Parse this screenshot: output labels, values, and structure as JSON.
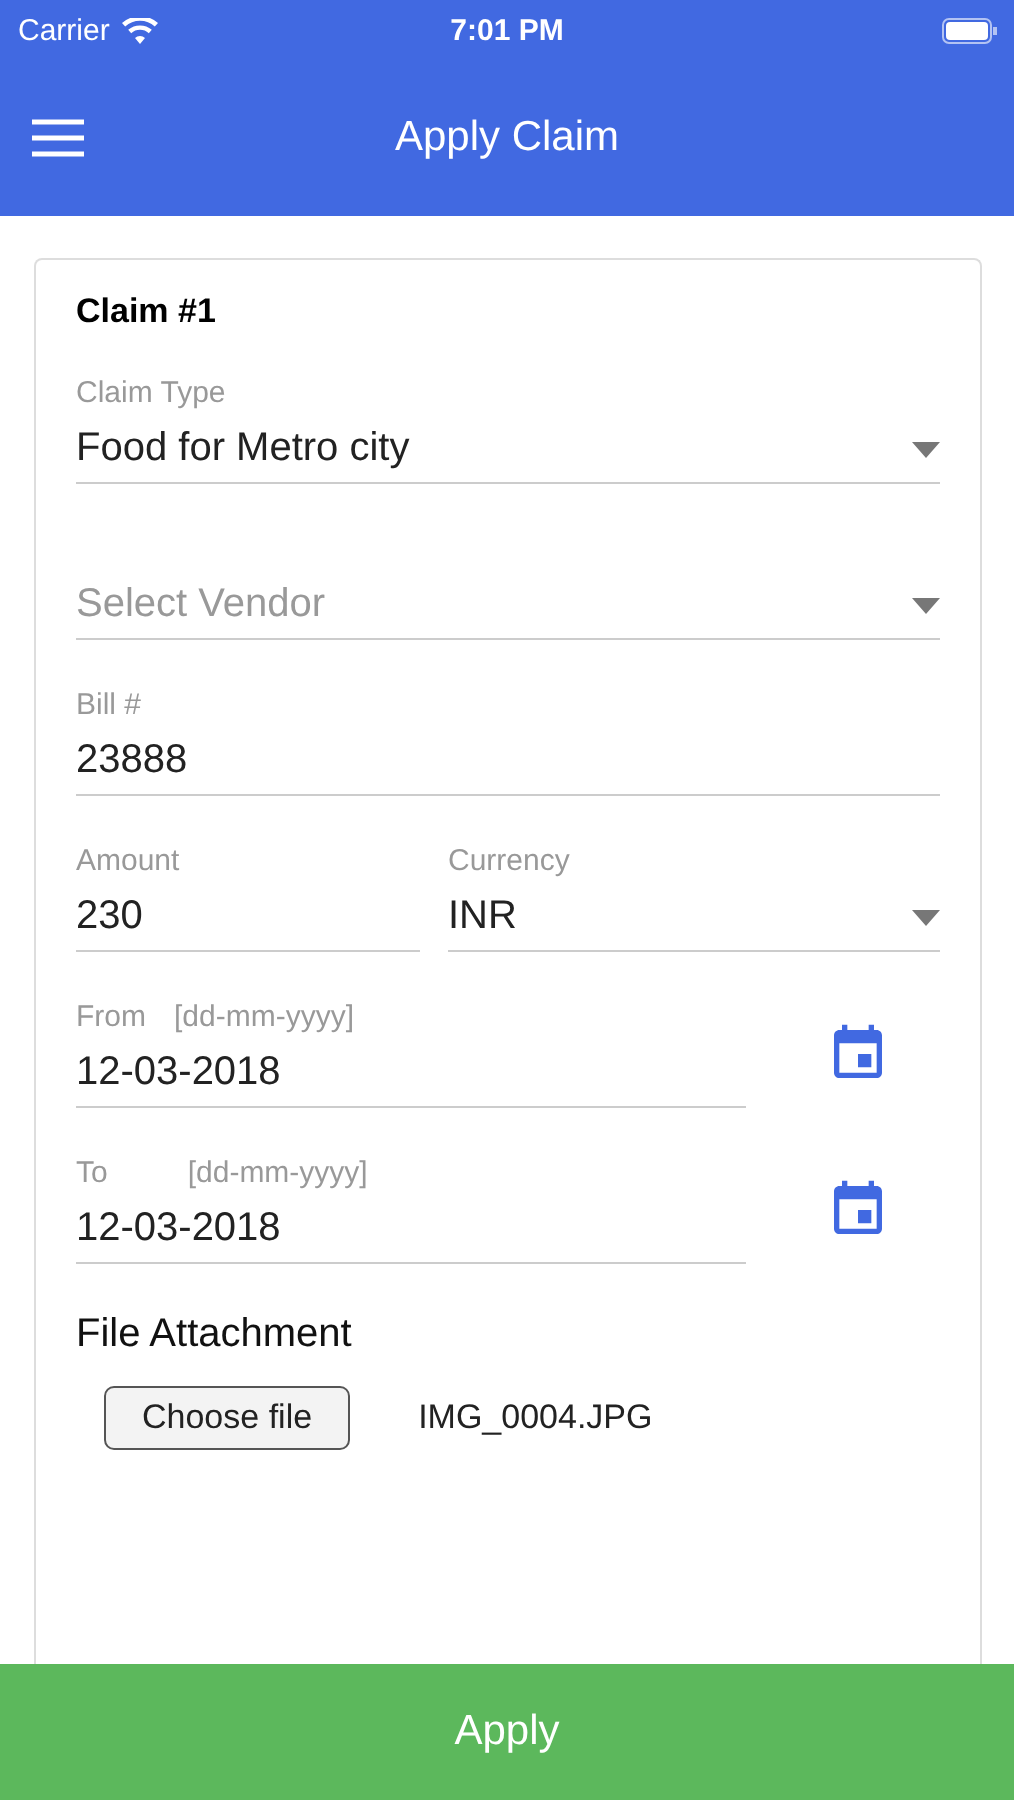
{
  "status_bar": {
    "carrier": "Carrier",
    "time": "7:01 PM"
  },
  "header": {
    "title": "Apply Claim"
  },
  "card": {
    "title": "Claim #1",
    "fields": [
      {
        "kind": "select",
        "label": "Claim Type",
        "value": "Food for Metro city"
      },
      {
        "kind": "select",
        "placeholder": "Select Vendor"
      },
      {
        "kind": "text",
        "label": "Bill #",
        "value": "23888"
      }
    ],
    "pair": [
      {
        "kind": "text",
        "label": "Amount",
        "value": "230"
      },
      {
        "kind": "select",
        "label": "Currency",
        "value": "INR"
      }
    ],
    "dates": [
      {
        "label": "From",
        "format": "[dd-mm-yyyy]",
        "value": "12-03-2018"
      },
      {
        "label": "To",
        "format": "[dd-mm-yyyy]",
        "value": "12-03-2018"
      }
    ],
    "attachment": {
      "title": "File Attachment",
      "button": "Choose file",
      "filename": "IMG_0004.JPG"
    }
  },
  "apply_button": "Apply"
}
